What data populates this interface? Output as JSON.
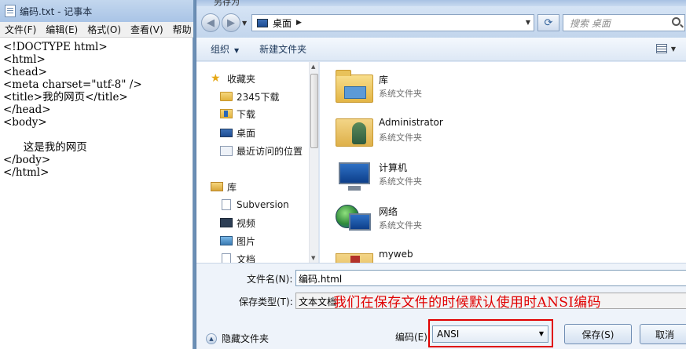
{
  "notepad": {
    "title": "编码.txt - 记事本",
    "menu": [
      "文件(F)",
      "编辑(E)",
      "格式(O)",
      "查看(V)",
      "帮助"
    ],
    "lines": [
      "<!DOCTYPE html>",
      "<html>",
      "<head>",
      "<meta charset=\"utf-8\" />",
      "<title>我的网页</title>",
      "</head>",
      "<body>",
      "",
      "      这是我的网页",
      "</body>",
      "</html>"
    ]
  },
  "dialog": {
    "title": "另存为",
    "address": "桌面",
    "search_placeholder": "搜索 桌面",
    "toolbar": {
      "organize": "组织",
      "new_folder": "新建文件夹"
    },
    "nav": [
      {
        "label": "收藏夹",
        "icon": "star-icon"
      },
      {
        "label": "2345下载",
        "icon": "folder-icon"
      },
      {
        "label": "下载",
        "icon": "download-folder-icon"
      },
      {
        "label": "桌面",
        "icon": "desktop-icon"
      },
      {
        "label": "最近访问的位置",
        "icon": "recent-places-icon"
      },
      {
        "label": "库",
        "icon": "library-icon"
      },
      {
        "label": "Subversion",
        "icon": "document-icon"
      },
      {
        "label": "视频",
        "icon": "video-icon"
      },
      {
        "label": "图片",
        "icon": "picture-icon"
      },
      {
        "label": "文档",
        "icon": "document-icon"
      }
    ],
    "files": [
      {
        "name": "库",
        "type": "系统文件夹",
        "icon": "library-folder-icon"
      },
      {
        "name": "Administrator",
        "type": "系统文件夹",
        "icon": "user-folder-icon"
      },
      {
        "name": "计算机",
        "type": "系统文件夹",
        "icon": "computer-icon"
      },
      {
        "name": "网络",
        "type": "系统文件夹",
        "icon": "network-icon"
      },
      {
        "name": "myweb",
        "type": "",
        "icon": "web-folder-icon"
      }
    ],
    "filename_label": "文件名(N):",
    "filename_value": "编码.html",
    "filetype_label": "保存类型(T):",
    "filetype_value": "文本文档",
    "annotation": "我们在保存文件的时候默认使用时ANSI编码",
    "hide_folders": "隐藏文件夹",
    "encoding_label": "编码(E)",
    "encoding_value": "ANSI",
    "save": "保存(S)",
    "cancel": "取消"
  }
}
